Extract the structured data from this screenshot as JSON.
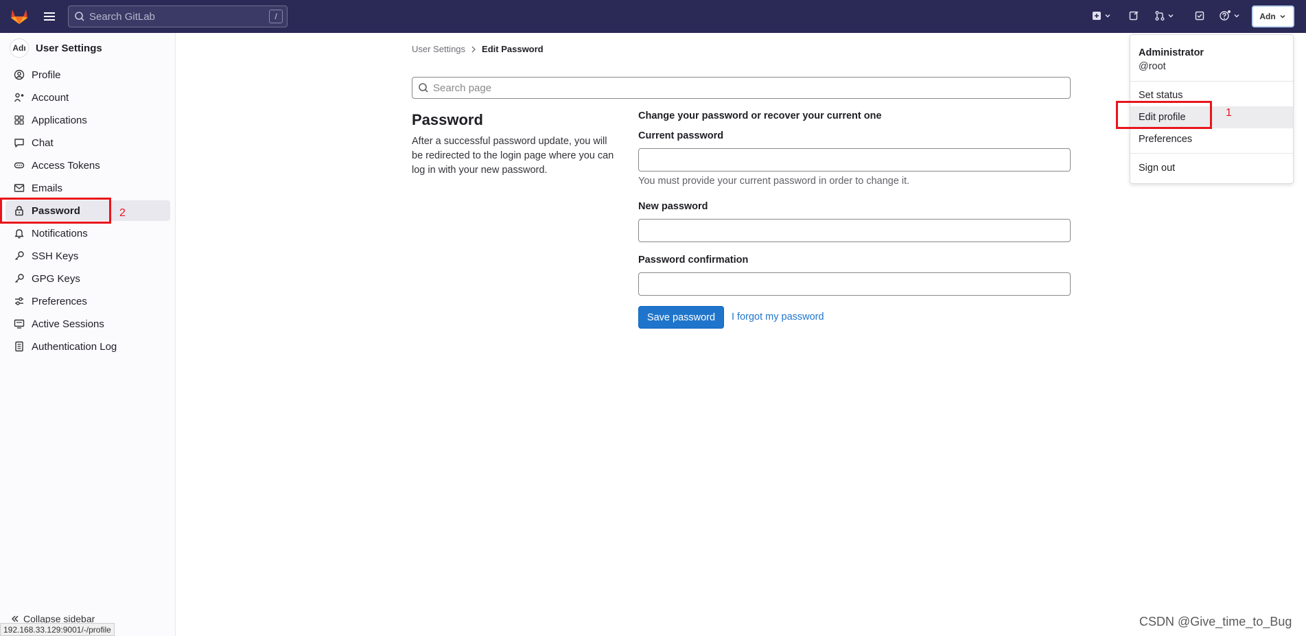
{
  "topbar": {
    "search_placeholder": "Search GitLab",
    "search_shortcut": "/",
    "avatar_label": "Adn"
  },
  "sidebar": {
    "avatar_label": "Adı",
    "title": "User Settings",
    "items": [
      {
        "label": "Profile",
        "icon": "user-icon"
      },
      {
        "label": "Account",
        "icon": "account-icon"
      },
      {
        "label": "Applications",
        "icon": "applications-icon"
      },
      {
        "label": "Chat",
        "icon": "chat-icon"
      },
      {
        "label": "Access Tokens",
        "icon": "token-icon"
      },
      {
        "label": "Emails",
        "icon": "mail-icon"
      },
      {
        "label": "Password",
        "icon": "lock-icon",
        "active": true
      },
      {
        "label": "Notifications",
        "icon": "bell-icon"
      },
      {
        "label": "SSH Keys",
        "icon": "key-icon"
      },
      {
        "label": "GPG Keys",
        "icon": "key-icon"
      },
      {
        "label": "Preferences",
        "icon": "preferences-icon"
      },
      {
        "label": "Active Sessions",
        "icon": "monitor-icon"
      },
      {
        "label": "Authentication Log",
        "icon": "log-icon"
      }
    ],
    "collapse_label": "Collapse sidebar"
  },
  "status_url": "192.168.33.129:9001/-/profile",
  "breadcrumb": {
    "parent": "User Settings",
    "current": "Edit Password"
  },
  "main": {
    "search_placeholder": "Search page",
    "title": "Password",
    "description": "After a successful password update, you will be redirected to the login page where you can log in with your new password.",
    "form_heading": "Change your password or recover your current one",
    "current_password_label": "Current password",
    "current_password_help": "You must provide your current password in order to change it.",
    "new_password_label": "New password",
    "confirmation_label": "Password confirmation",
    "save_button": "Save password",
    "forgot_link": "I forgot my password"
  },
  "user_menu": {
    "name": "Administrator",
    "username": "@root",
    "items": [
      "Set status",
      "Edit profile",
      "Preferences",
      "Sign out"
    ]
  },
  "annotations": {
    "one": "1",
    "two": "2",
    "color": "#e8151b"
  },
  "watermark": "CSDN @Give_time_to_Bug",
  "colors": {
    "topbar": "#2b2956",
    "primary": "#1f75cb"
  }
}
